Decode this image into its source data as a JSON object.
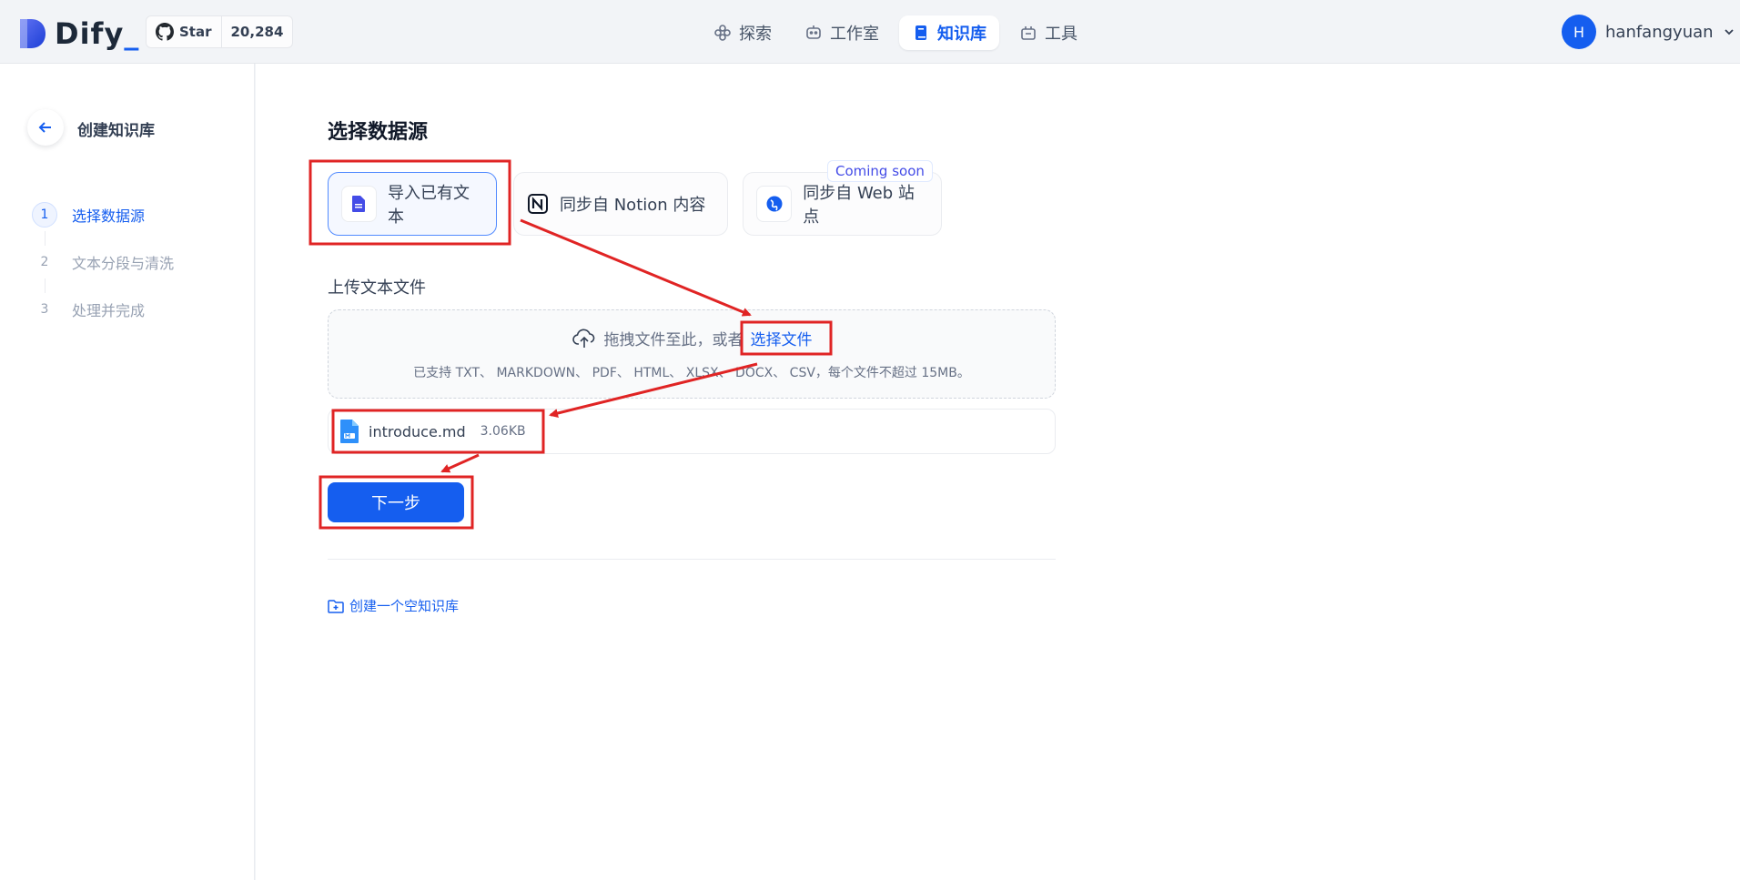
{
  "header": {
    "logo_text": "Dify",
    "github": {
      "star_label": "Star",
      "star_count": "20,284"
    },
    "nav": [
      {
        "label": "探索",
        "icon": "explore-icon",
        "active": false
      },
      {
        "label": "工作室",
        "icon": "robot-icon",
        "active": false
      },
      {
        "label": "知识库",
        "icon": "book-icon",
        "active": true
      },
      {
        "label": "工具",
        "icon": "toolbox-icon",
        "active": false
      }
    ],
    "user": {
      "avatar_initial": "H",
      "name": "hanfangyuan"
    }
  },
  "sidebar": {
    "title": "创建知识库",
    "steps": [
      {
        "num": "1",
        "label": "选择数据源",
        "active": true
      },
      {
        "num": "2",
        "label": "文本分段与清洗",
        "active": false
      },
      {
        "num": "3",
        "label": "处理并完成",
        "active": false
      }
    ]
  },
  "main": {
    "section_title": "选择数据源",
    "sources": [
      {
        "label": "导入已有文本",
        "icon": "file-text-icon",
        "active": true
      },
      {
        "label": "同步自 Notion 内容",
        "icon": "notion-icon",
        "active": false
      },
      {
        "label": "同步自 Web 站点",
        "icon": "web-icon",
        "active": false
      }
    ],
    "coming_soon": "Coming soon",
    "upload_label": "上传文本文件",
    "dropzone": {
      "prompt": "拖拽文件至此，或者",
      "link": "选择文件",
      "hint": "已支持 TXT、 MARKDOWN、 PDF、 HTML、 XLSX、 DOCX、 CSV，每个文件不超过 15MB。"
    },
    "file": {
      "name": "introduce.md",
      "size": "3.06KB"
    },
    "next_button": "下一步",
    "empty_kb_link": "创建一个空知识库"
  },
  "colors": {
    "accent": "#155eef",
    "annotation_red": "#e02424"
  }
}
